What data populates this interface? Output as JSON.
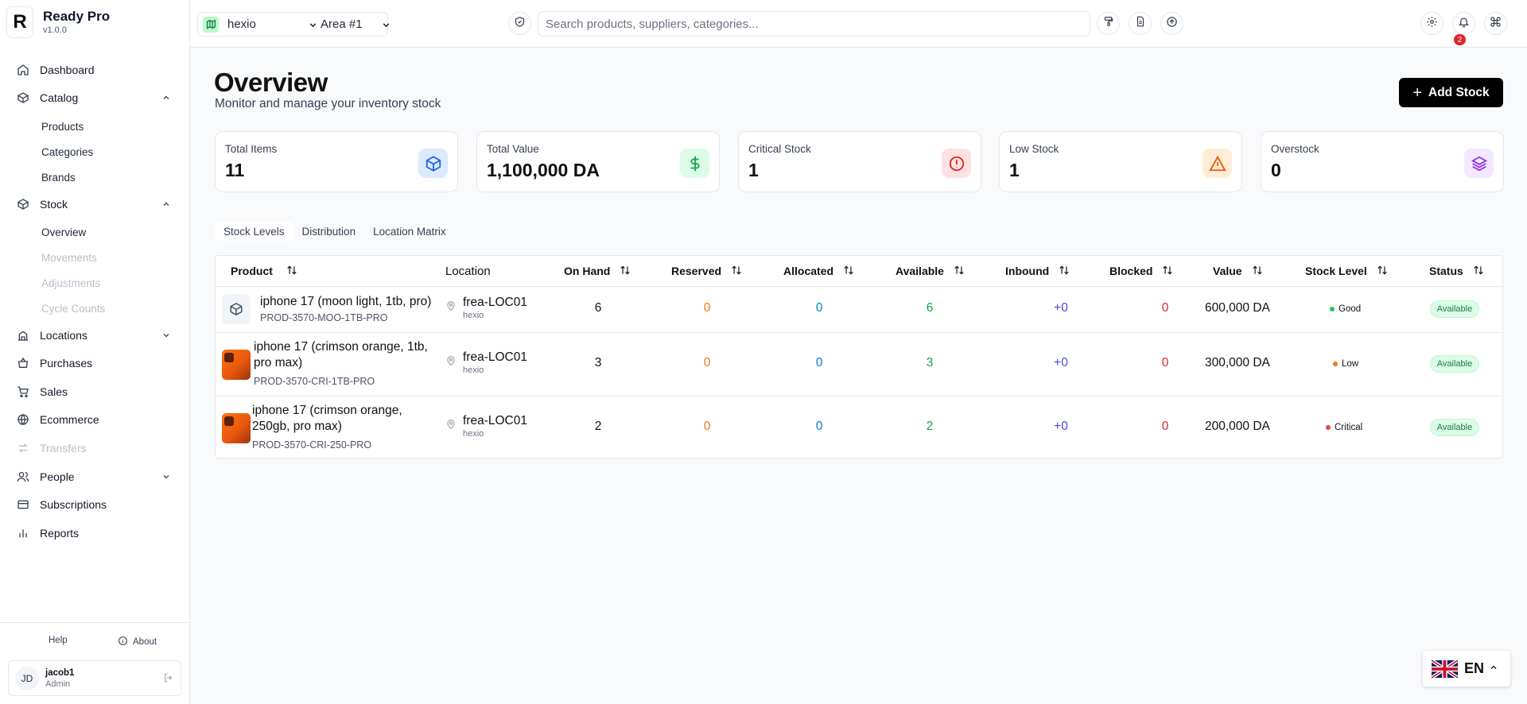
{
  "app": {
    "name": "Ready Pro",
    "version": "v1.0.0",
    "logo_letter": "R"
  },
  "sidebar": {
    "items": [
      {
        "label": "Dashboard",
        "icon": "home-icon"
      },
      {
        "label": "Catalog",
        "icon": "box-icon",
        "expanded": true,
        "children": [
          {
            "label": "Products"
          },
          {
            "label": "Categories"
          },
          {
            "label": "Brands"
          }
        ]
      },
      {
        "label": "Stock",
        "icon": "box-icon",
        "expanded": true,
        "children": [
          {
            "label": "Overview",
            "active": true
          },
          {
            "label": "Movements",
            "disabled": true
          },
          {
            "label": "Adjustments",
            "disabled": true
          },
          {
            "label": "Cycle Counts",
            "disabled": true
          }
        ]
      },
      {
        "label": "Locations",
        "icon": "building-icon",
        "expanded": false
      },
      {
        "label": "Purchases",
        "icon": "shopping-bag-icon"
      },
      {
        "label": "Sales",
        "icon": "cart-icon"
      },
      {
        "label": "Ecommerce",
        "icon": "globe-icon"
      },
      {
        "label": "Transfers",
        "icon": "transfer-icon",
        "disabled": true
      },
      {
        "label": "People",
        "icon": "users-icon",
        "expanded": false
      },
      {
        "label": "Subscriptions",
        "icon": "card-icon"
      },
      {
        "label": "Reports",
        "icon": "bar-chart-icon"
      }
    ],
    "footer": {
      "help": "Help",
      "about": "About"
    },
    "user": {
      "initials": "JD",
      "name": "jacob1",
      "role": "Admin"
    }
  },
  "topbar": {
    "workspace": "hexio",
    "area": "Area #1",
    "search_placeholder": "Search products, suppliers, categories...",
    "notification_count": "2"
  },
  "page": {
    "title": "Overview",
    "subtitle": "Monitor and manage your inventory stock",
    "add_button": "Add Stock"
  },
  "stats": [
    {
      "label": "Total Items",
      "value": "11",
      "icon": "cube-icon",
      "color": "#2563eb",
      "bg": "#dbeafe"
    },
    {
      "label": "Total Value",
      "value": "1,100,000 DA",
      "icon": "dollar-icon",
      "color": "#16a34a",
      "bg": "#dcfce7"
    },
    {
      "label": "Critical Stock",
      "value": "1",
      "icon": "alert-circle-icon",
      "color": "#dc2626",
      "bg": "#fee2e2"
    },
    {
      "label": "Low Stock",
      "value": "1",
      "icon": "warning-triangle-icon",
      "color": "#ea580c",
      "bg": "#ffedd5"
    },
    {
      "label": "Overstock",
      "value": "0",
      "icon": "layers-icon",
      "color": "#9333ea",
      "bg": "#f3e8ff"
    }
  ],
  "tabs": [
    {
      "label": "Stock Levels",
      "active": true
    },
    {
      "label": "Distribution"
    },
    {
      "label": "Location Matrix"
    }
  ],
  "table": {
    "columns": [
      "Product",
      "Location",
      "On Hand",
      "Reserved",
      "Allocated",
      "Available",
      "Inbound",
      "Blocked",
      "Value",
      "Stock Level",
      "Status"
    ],
    "rows": [
      {
        "name": "iphone 17 (moon light, 1tb, pro)",
        "sku": "PROD-3570-MOO-1TB-PRO",
        "thumb": "box",
        "location": "frea-LOC01",
        "location_sub": "hexio",
        "on_hand": "6",
        "reserved": "0",
        "allocated": "0",
        "available": "6",
        "inbound": "+0",
        "blocked": "0",
        "value": "600,000 DA",
        "level": "Good",
        "level_color": "#22c55e",
        "status": "Available"
      },
      {
        "name": "iphone 17 (crimson orange, 1tb, pro max)",
        "sku": "PROD-3570-CRI-1TB-PRO",
        "thumb": "phone",
        "location": "frea-LOC01",
        "location_sub": "hexio",
        "on_hand": "3",
        "reserved": "0",
        "allocated": "0",
        "available": "3",
        "inbound": "+0",
        "blocked": "0",
        "value": "300,000 DA",
        "level": "Low",
        "level_color": "#f97316",
        "status": "Available"
      },
      {
        "name": "iphone 17 (crimson orange, 250gb, pro max)",
        "sku": "PROD-3570-CRI-250-PRO",
        "thumb": "phone",
        "location": "frea-LOC01",
        "location_sub": "hexio",
        "on_hand": "2",
        "reserved": "0",
        "allocated": "0",
        "available": "2",
        "inbound": "+0",
        "blocked": "0",
        "value": "200,000 DA",
        "level": "Critical",
        "level_color": "#ef4444",
        "status": "Available"
      }
    ]
  },
  "language": {
    "code": "EN",
    "flag": "uk-flag-icon"
  }
}
